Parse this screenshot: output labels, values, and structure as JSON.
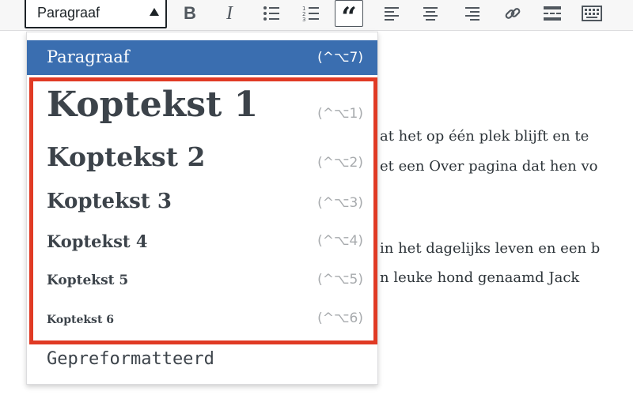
{
  "toolbar": {
    "format_select_value": "Paragraaf",
    "buttons": [
      "bold",
      "italic",
      "bulleted-list",
      "numbered-list",
      "blockquote",
      "align-left",
      "align-center",
      "align-right",
      "link",
      "read-more",
      "toolbar-toggle"
    ],
    "bold_label": "B",
    "italic_label": "I",
    "blockquote_label": "“"
  },
  "content_lines": [
    "at het op één plek blijft en te",
    "et een Over pagina dat hen vo",
    "in het dagelijks leven en een b",
    "n leuke hond genaamd Jack"
  ],
  "dropdown": {
    "items": [
      {
        "label": "Paragraaf",
        "shortcut": "(^⌥7)"
      },
      {
        "label": "Koptekst 1",
        "shortcut": "(^⌥1)"
      },
      {
        "label": "Koptekst 2",
        "shortcut": "(^⌥2)"
      },
      {
        "label": "Koptekst 3",
        "shortcut": "(^⌥3)"
      },
      {
        "label": "Koptekst 4",
        "shortcut": "(^⌥4)"
      },
      {
        "label": "Koptekst 5",
        "shortcut": "(^⌥5)"
      },
      {
        "label": "Koptekst 6",
        "shortcut": "(^⌥6)"
      },
      {
        "label": "Gepreformatteerd",
        "shortcut": ""
      }
    ]
  },
  "colors": {
    "selected_bg": "#3a6eb0",
    "highlight_border": "#e03a24"
  }
}
